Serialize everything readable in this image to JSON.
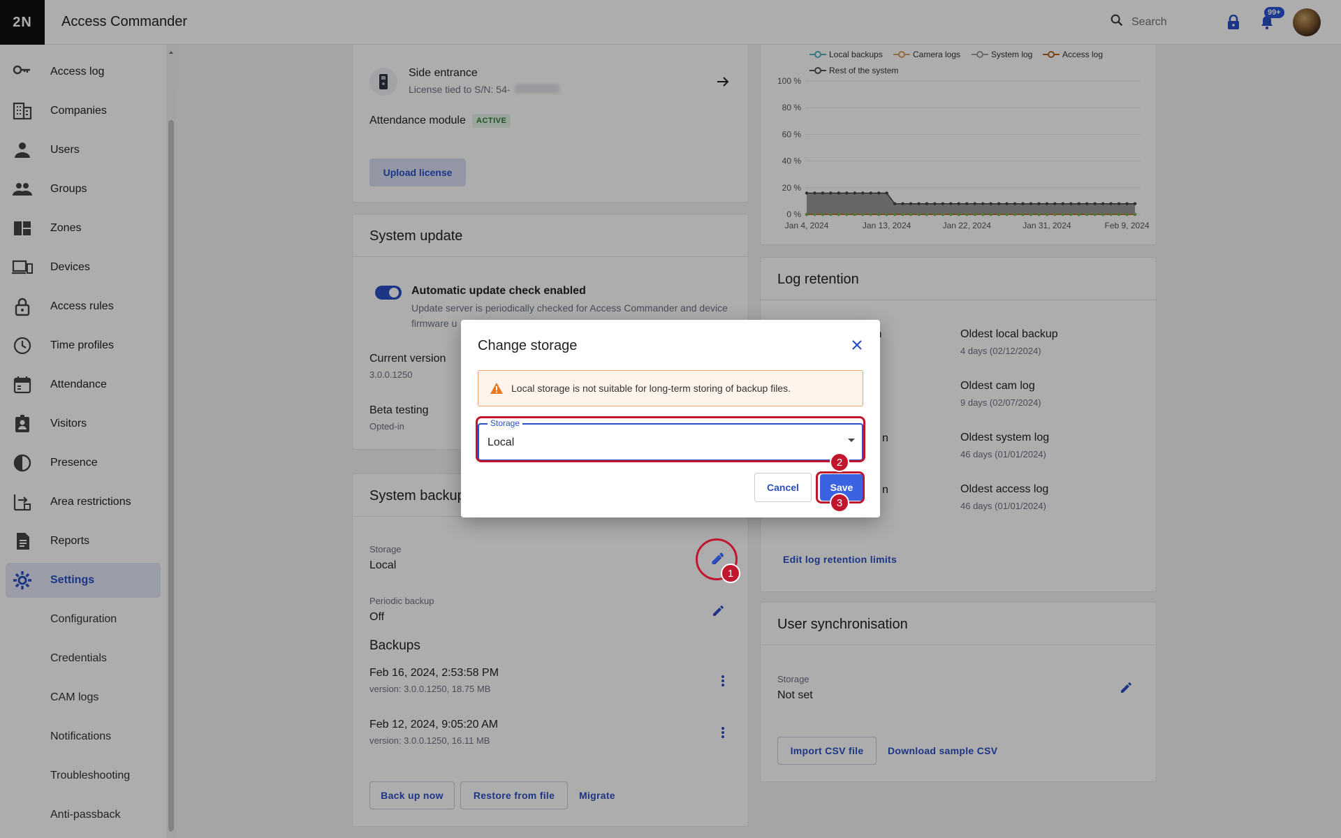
{
  "app": {
    "logo": "2N",
    "title": "Access Commander"
  },
  "header": {
    "search_placeholder": "Search",
    "notification_count": "99+"
  },
  "sidebar": {
    "items": [
      {
        "label": "Access log",
        "icon": "key-icon"
      },
      {
        "label": "Companies",
        "icon": "building-icon"
      },
      {
        "label": "Users",
        "icon": "person-icon"
      },
      {
        "label": "Groups",
        "icon": "people-icon"
      },
      {
        "label": "Zones",
        "icon": "zones-icon"
      },
      {
        "label": "Devices",
        "icon": "devices-icon"
      },
      {
        "label": "Access rules",
        "icon": "lock-icon"
      },
      {
        "label": "Time profiles",
        "icon": "clock-icon"
      },
      {
        "label": "Attendance",
        "icon": "calendar-icon"
      },
      {
        "label": "Visitors",
        "icon": "badge-icon"
      },
      {
        "label": "Presence",
        "icon": "presence-icon"
      },
      {
        "label": "Area restrictions",
        "icon": "area-icon"
      },
      {
        "label": "Reports",
        "icon": "report-icon"
      },
      {
        "label": "Settings",
        "icon": "gear-icon"
      }
    ],
    "sub_items": [
      {
        "label": "Configuration"
      },
      {
        "label": "Credentials"
      },
      {
        "label": "CAM logs"
      },
      {
        "label": "Notifications"
      },
      {
        "label": "Troubleshooting"
      },
      {
        "label": "Anti-passback"
      }
    ]
  },
  "license": {
    "device_name": "Side entrance",
    "device_sub": "License tied to S/N: 54-",
    "attendance_label": "Attendance module",
    "attendance_status": "ACTIVE",
    "upload_button": "Upload license"
  },
  "system_update": {
    "title": "System update",
    "auto_label": "Automatic update check enabled",
    "auto_desc_1": "Update server is periodically checked for Access Commander and device",
    "auto_desc_2": "firmware u",
    "current_version_label": "Current version",
    "current_version": "3.0.0.1250",
    "beta_label": "Beta testing",
    "beta_value": "Opted-in"
  },
  "system_backup": {
    "title": "System backup",
    "storage_label": "Storage",
    "storage_value": "Local",
    "periodic_label": "Periodic backup",
    "periodic_value": "Off",
    "backups_title": "Backups",
    "backups": [
      {
        "date": "Feb 16, 2024, 2:53:58 PM",
        "meta": "version: 3.0.0.1250, 18.75 MB"
      },
      {
        "date": "Feb 12, 2024, 9:05:20 AM",
        "meta": "version: 3.0.0.1250, 16.11 MB"
      }
    ],
    "back_up_now": "Back up now",
    "restore": "Restore from file",
    "migrate": "Migrate"
  },
  "chart_data": {
    "type": "area",
    "title": "",
    "xlabel": "",
    "ylabel": "",
    "ylim": [
      0,
      100
    ],
    "y_ticks": [
      "100 %",
      "80 %",
      "60 %",
      "40 %",
      "20 %",
      "0 %"
    ],
    "x_ticks": [
      "Jan 4, 2024",
      "Jan 13, 2024",
      "Jan 22, 2024",
      "Jan 31, 2024",
      "Feb 9, 2024"
    ],
    "legend_position": "top",
    "series": [
      {
        "name": "Local backups",
        "color": "#4fb3bf",
        "values": [
          0,
          0,
          0,
          0,
          0,
          0,
          0,
          0,
          0,
          0,
          0,
          0,
          0,
          0,
          0,
          0,
          0,
          0,
          0,
          0,
          0,
          0,
          0,
          0,
          0,
          0,
          0,
          0,
          0,
          0,
          0,
          0,
          0,
          0,
          0,
          0,
          0,
          0,
          0,
          0,
          0,
          0
        ]
      },
      {
        "name": "Camera logs",
        "color": "#e0a060",
        "values": [
          0,
          0,
          0,
          0,
          0,
          0,
          0,
          0,
          0,
          0,
          0,
          0,
          0,
          0,
          0,
          0,
          0,
          0,
          0,
          0,
          0,
          0,
          0,
          0,
          0,
          0,
          0,
          0,
          0,
          0,
          0,
          0,
          0,
          0,
          0,
          0,
          0,
          0,
          0,
          0,
          0,
          0
        ]
      },
      {
        "name": "System log",
        "color": "#9aa0a6",
        "values": [
          0,
          0,
          0,
          0,
          0,
          0,
          0,
          0,
          0,
          0,
          0,
          0,
          0,
          0,
          0,
          0,
          0,
          0,
          0,
          0,
          0,
          0,
          0,
          0,
          0,
          0,
          0,
          0,
          0,
          0,
          0,
          0,
          0,
          0,
          0,
          0,
          0,
          0,
          0,
          0,
          0,
          0
        ]
      },
      {
        "name": "Access log",
        "color": "#b5651d",
        "values": [
          0,
          0,
          0,
          0,
          0,
          0,
          0,
          0,
          0,
          0,
          0,
          0,
          0,
          0,
          0,
          0,
          0,
          0,
          0,
          0,
          0,
          0,
          0,
          0,
          0,
          0,
          0,
          0,
          0,
          0,
          0,
          0,
          0,
          0,
          0,
          0,
          0,
          0,
          0,
          0,
          0,
          0
        ]
      },
      {
        "name": "Rest of the system",
        "color": "#555555",
        "values": [
          16,
          16,
          16,
          16,
          16,
          16,
          16,
          16,
          16,
          16,
          16,
          8,
          8,
          8,
          8,
          8,
          8,
          8,
          8,
          8,
          8,
          8,
          8,
          8,
          8,
          8,
          8,
          8,
          8,
          8,
          8,
          8,
          8,
          8,
          8,
          8,
          8,
          8,
          8,
          8,
          8,
          8
        ]
      }
    ]
  },
  "log_retention": {
    "title": "Log retention",
    "left_frag": [
      "ion",
      "",
      "n",
      "n"
    ],
    "items": [
      {
        "label": "Oldest local backup",
        "value": "4 days (02/12/2024)"
      },
      {
        "label": "Oldest cam log",
        "value": "9 days (02/07/2024)"
      },
      {
        "label": "Oldest system log",
        "value": "46 days (01/01/2024)"
      },
      {
        "label": "Oldest access log",
        "value": "46 days (01/01/2024)"
      }
    ],
    "edit_button": "Edit log retention limits"
  },
  "user_sync": {
    "title": "User synchronisation",
    "storage_label": "Storage",
    "storage_value": "Not set",
    "import_button": "Import CSV file",
    "download_button": "Download sample CSV"
  },
  "dialog": {
    "title": "Change storage",
    "alert": "Local storage is not suitable for long-term storing of backup files.",
    "select_label": "Storage",
    "select_value": "Local",
    "cancel": "Cancel",
    "save": "Save",
    "markers": [
      "1",
      "2",
      "3"
    ]
  },
  "colors": {
    "accent": "#2a4fc4",
    "marker": "#c0162e",
    "save": "#3b62e0"
  }
}
